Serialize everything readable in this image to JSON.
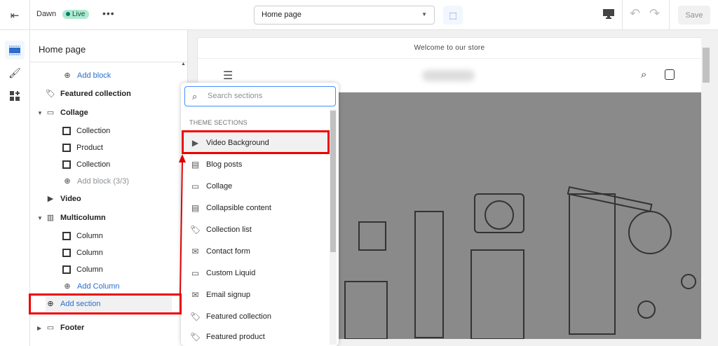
{
  "topbar": {
    "theme_name": "Dawn",
    "status": "Live",
    "more": "•••",
    "page_select": "Home page",
    "save": "Save"
  },
  "panel": {
    "title": "Home page",
    "items": [
      {
        "label": "Add block",
        "kind": "add"
      },
      {
        "label": "Featured collection",
        "kind": "section"
      },
      {
        "label": "Collage",
        "kind": "section"
      },
      {
        "label": "Collection",
        "kind": "block"
      },
      {
        "label": "Product",
        "kind": "block"
      },
      {
        "label": "Collection",
        "kind": "block"
      },
      {
        "label": "Add block (3/3)",
        "kind": "add-disabled"
      },
      {
        "label": "Video",
        "kind": "section"
      },
      {
        "label": "Multicolumn",
        "kind": "section"
      },
      {
        "label": "Column",
        "kind": "block"
      },
      {
        "label": "Column",
        "kind": "block"
      },
      {
        "label": "Column",
        "kind": "block"
      },
      {
        "label": "Add Column",
        "kind": "add"
      },
      {
        "label": "Add section",
        "kind": "add-section"
      },
      {
        "label": "Footer",
        "kind": "section"
      }
    ]
  },
  "preview": {
    "announcement": "Welcome to our store"
  },
  "popup": {
    "search_placeholder": "Search sections",
    "heading": "THEME SECTIONS",
    "items": [
      "Video Background",
      "Blog posts",
      "Collage",
      "Collapsible content",
      "Collection list",
      "Contact form",
      "Custom Liquid",
      "Email signup",
      "Featured collection",
      "Featured product"
    ]
  },
  "colors": {
    "accent": "#2c6ecb",
    "highlight": "#e00000",
    "live_bg": "#aee9d1"
  }
}
